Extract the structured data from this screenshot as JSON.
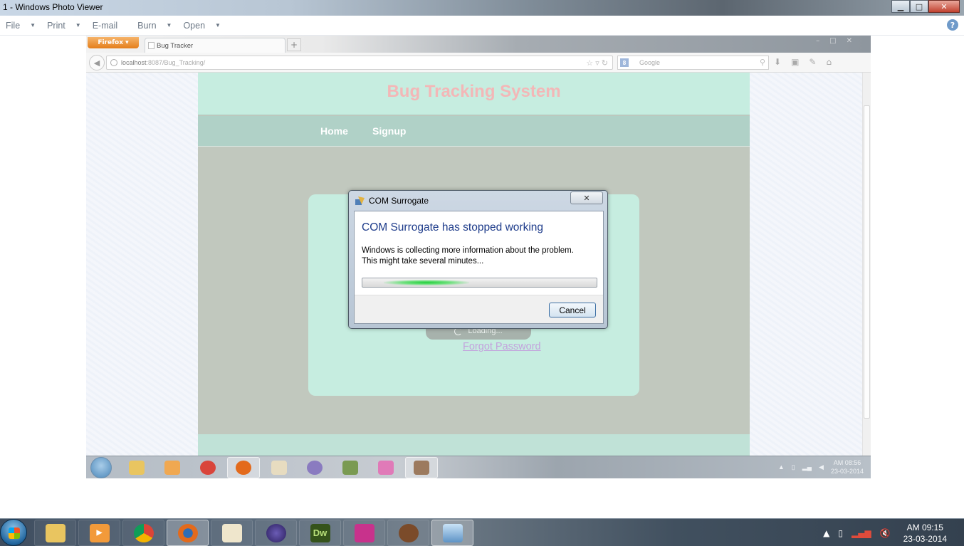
{
  "photo_viewer": {
    "title": "1 - Windows Photo Viewer",
    "menu": [
      {
        "label": "File",
        "has_caret": true
      },
      {
        "label": "Print",
        "has_caret": true
      },
      {
        "label": "E-mail",
        "has_caret": false
      },
      {
        "label": "Burn",
        "has_caret": true
      },
      {
        "label": "Open",
        "has_caret": true
      }
    ],
    "help": "?",
    "window_buttons": {
      "minimize": "▁",
      "maximize": "□",
      "close": "✕"
    }
  },
  "browser": {
    "menu_button": "Firefox ▾",
    "tab_title": "Bug Tracker",
    "new_tab": "+",
    "url_host": "localhost",
    "url_rest": ":8087/Bug_Tracking/",
    "search_placeholder": "Google",
    "search_engine_icon": "google-icon"
  },
  "site": {
    "title": "Bug Tracking System",
    "nav": [
      "Home",
      "Signup"
    ],
    "loading_label": "Loading...",
    "forgot_password": "Forgot Password"
  },
  "inner_taskbar": {
    "clock_time": "AM 08:56",
    "clock_date": "23-03-2014"
  },
  "dialog": {
    "title": "COM Surrogate",
    "close": "✕",
    "heading": "COM Surrogate has stopped working",
    "line1": "Windows is collecting more information about the problem.",
    "line2": "This might take several minutes...",
    "cancel": "Cancel"
  },
  "taskbar": {
    "apps": [
      {
        "name": "explorer",
        "color": "#e9c560",
        "active": false
      },
      {
        "name": "media-player",
        "color": "#f29a3a",
        "active": false
      },
      {
        "name": "chrome",
        "color": "#d9453b",
        "active": false
      },
      {
        "name": "firefox",
        "color": "#e36a1c",
        "active": true
      },
      {
        "name": "tomcat",
        "color": "#d8c9a0",
        "active": false
      },
      {
        "name": "eclipse",
        "color": "#4b3a8e",
        "active": false
      },
      {
        "name": "dreamweaver",
        "color": "#35531b",
        "label": "Dw",
        "active": false
      },
      {
        "name": "app-pink",
        "color": "#c8328c",
        "active": false
      },
      {
        "name": "java-ee-ide",
        "color": "#7b4b2a",
        "active": false
      },
      {
        "name": "photo-viewer",
        "color": "#5e93c6",
        "active": true
      }
    ],
    "clock_time": "AM 09:15",
    "clock_date": "23-03-2014"
  }
}
